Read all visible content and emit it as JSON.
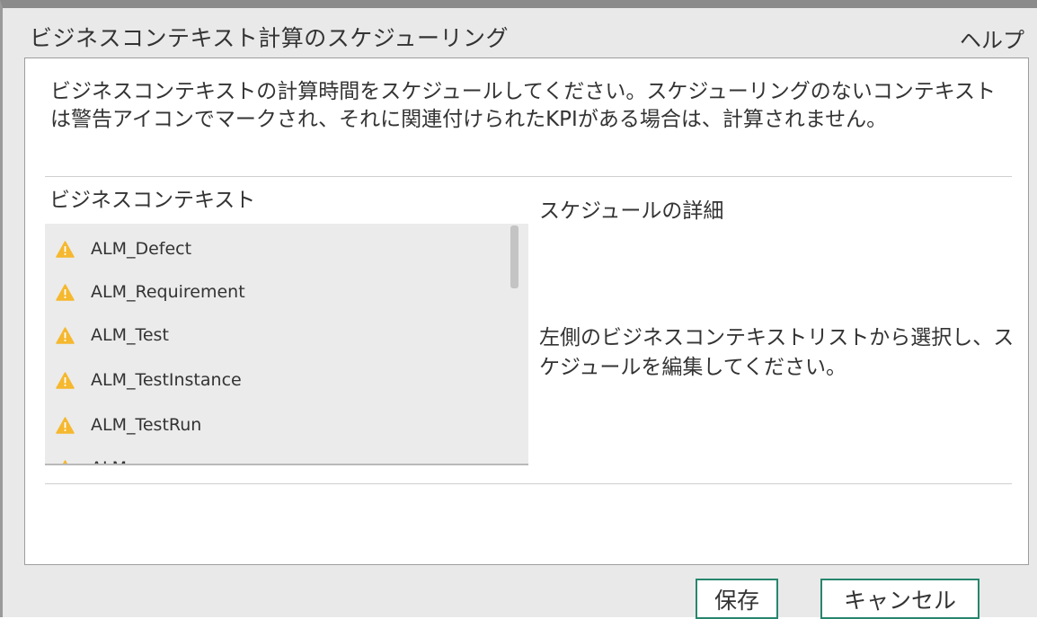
{
  "dialog": {
    "title": "ビジネスコンテキスト計算のスケジューリング",
    "help_label": "ヘルプ"
  },
  "description": "ビジネスコンテキストの計算時間をスケジュールしてください。スケジューリングのないコンテキストは警告アイコンでマークされ、それに関連付けられたKPIがある場合は、計算されません。",
  "business_contexts": {
    "heading": "ビジネスコンテキスト",
    "items": [
      {
        "label": "ALM_Defect",
        "icon": "warning-icon"
      },
      {
        "label": "ALM_Requirement",
        "icon": "warning-icon"
      },
      {
        "label": "ALM_Test",
        "icon": "warning-icon"
      },
      {
        "label": "ALM_TestInstance",
        "icon": "warning-icon"
      },
      {
        "label": "ALM_TestRun",
        "icon": "warning-icon"
      },
      {
        "label": "ALM_...",
        "icon": "warning-icon"
      }
    ]
  },
  "schedule_details": {
    "heading": "スケジュールの詳細",
    "message": "左側のビジネスコンテキストリストから選択し、スケジュールを編集してください。"
  },
  "buttons": {
    "save": "保存",
    "cancel": "キャンセル"
  },
  "colors": {
    "warning": "#f5b82e",
    "button_border": "#27866d"
  }
}
